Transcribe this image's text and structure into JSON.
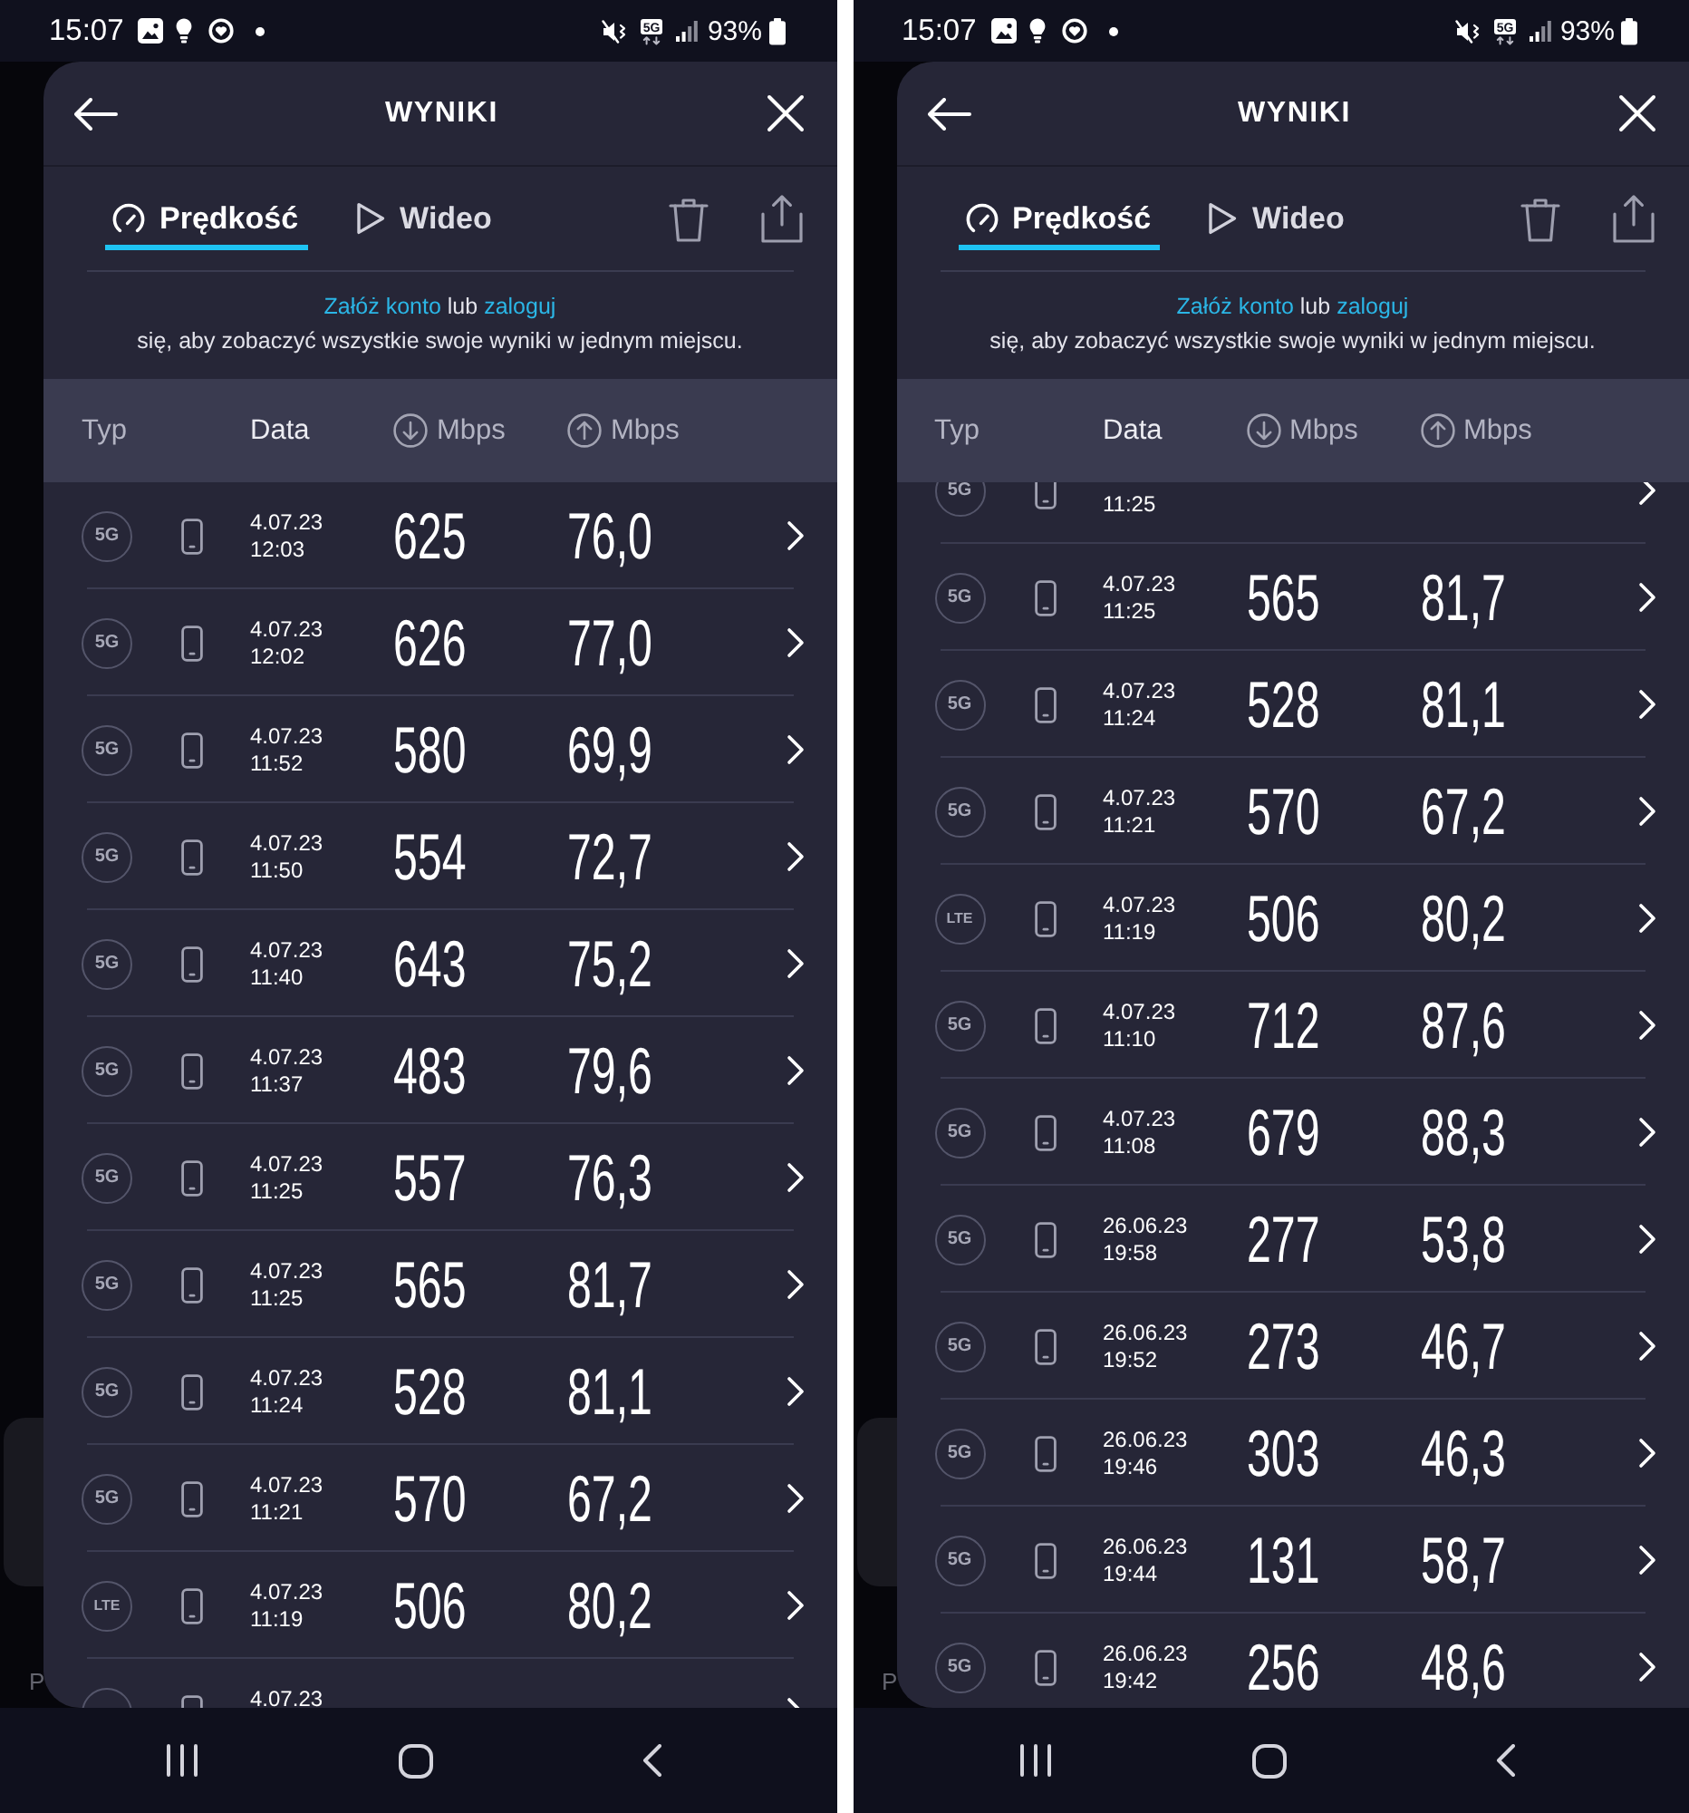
{
  "screens": [
    {
      "status_bar": {
        "time": "15:07",
        "network": "5G",
        "battery": "93%"
      },
      "background": {
        "text": "P"
      },
      "header": {
        "title": "WYNIKI"
      },
      "tabs": [
        {
          "label": "Prędkość",
          "kind": "speed",
          "selected": true
        },
        {
          "label": "Wideo",
          "kind": "video",
          "selected": false
        }
      ],
      "notice": {
        "lines": [
          [
            {
              "text": "Załóż konto",
              "kind": "link"
            },
            {
              "text": "lub",
              "kind": "text"
            },
            {
              "text": "zaloguj",
              "kind": "link"
            }
          ],
          [
            {
              "text": "się, aby zobaczyć wszystkie swoje wyniki w jednym miejscu.",
              "kind": "text"
            }
          ]
        ]
      },
      "table": {
        "columns": [
          {
            "label": "Typ",
            "selected": false
          },
          {
            "label": "Data",
            "selected": true
          },
          {
            "label": "Mbps",
            "kind": "download",
            "selected": false
          },
          {
            "label": "Mbps",
            "kind": "upload",
            "selected": false
          }
        ],
        "rows": [
          {
            "network": "5G",
            "date": "4.07.23",
            "time": "12:03",
            "download": "625",
            "upload": "76,0"
          },
          {
            "network": "5G",
            "date": "4.07.23",
            "time": "12:02",
            "download": "626",
            "upload": "77,0"
          },
          {
            "network": "5G",
            "date": "4.07.23",
            "time": "11:52",
            "download": "580",
            "upload": "69,9"
          },
          {
            "network": "5G",
            "date": "4.07.23",
            "time": "11:50",
            "download": "554",
            "upload": "72,7"
          },
          {
            "network": "5G",
            "date": "4.07.23",
            "time": "11:40",
            "download": "643",
            "upload": "75,2"
          },
          {
            "network": "5G",
            "date": "4.07.23",
            "time": "11:37",
            "download": "483",
            "upload": "79,6"
          },
          {
            "network": "5G",
            "date": "4.07.23",
            "time": "11:25",
            "download": "557",
            "upload": "76,3"
          },
          {
            "network": "5G",
            "date": "4.07.23",
            "time": "11:25",
            "download": "565",
            "upload": "81,7"
          },
          {
            "network": "5G",
            "date": "4.07.23",
            "time": "11:24",
            "download": "528",
            "upload": "81,1"
          },
          {
            "network": "5G",
            "date": "4.07.23",
            "time": "11:21",
            "download": "570",
            "upload": "67,2"
          },
          {
            "network": "LTE",
            "date": "4.07.23",
            "time": "11:19",
            "download": "506",
            "upload": "80,2"
          },
          {
            "date": "4.07.23"
          }
        ]
      }
    },
    {
      "status_bar": {
        "time": "15:07",
        "network": "5G",
        "battery": "93%"
      },
      "background": {
        "text": "P"
      },
      "header": {
        "title": "WYNIKI"
      },
      "tabs": [
        {
          "label": "Prędkość",
          "kind": "speed",
          "selected": true
        },
        {
          "label": "Wideo",
          "kind": "video",
          "selected": false
        }
      ],
      "notice": {
        "lines": [
          [
            {
              "text": "Załóż konto",
              "kind": "link"
            },
            {
              "text": "lub",
              "kind": "text"
            },
            {
              "text": "zaloguj",
              "kind": "link"
            }
          ],
          [
            {
              "text": "się, aby zobaczyć wszystkie swoje wyniki w jednym miejscu.",
              "kind": "text"
            }
          ]
        ]
      },
      "table": {
        "columns": [
          {
            "label": "Typ",
            "selected": false
          },
          {
            "label": "Data",
            "selected": true
          },
          {
            "label": "Mbps",
            "kind": "download",
            "selected": false
          },
          {
            "label": "Mbps",
            "kind": "upload",
            "selected": false
          }
        ],
        "rows": [
          {
            "network": "5G",
            "time": "11:25",
            "clipped": true
          },
          {
            "network": "5G",
            "date": "4.07.23",
            "time": "11:25",
            "download": "565",
            "upload": "81,7"
          },
          {
            "network": "5G",
            "date": "4.07.23",
            "time": "11:24",
            "download": "528",
            "upload": "81,1"
          },
          {
            "network": "5G",
            "date": "4.07.23",
            "time": "11:21",
            "download": "570",
            "upload": "67,2"
          },
          {
            "network": "LTE",
            "date": "4.07.23",
            "time": "11:19",
            "download": "506",
            "upload": "80,2"
          },
          {
            "network": "5G",
            "date": "4.07.23",
            "time": "11:10",
            "download": "712",
            "upload": "87,6"
          },
          {
            "network": "5G",
            "date": "4.07.23",
            "time": "11:08",
            "download": "679",
            "upload": "88,3"
          },
          {
            "network": "5G",
            "date": "26.06.23",
            "time": "19:58",
            "download": "277",
            "upload": "53,8"
          },
          {
            "network": "5G",
            "date": "26.06.23",
            "time": "19:52",
            "download": "273",
            "upload": "46,7"
          },
          {
            "network": "5G",
            "date": "26.06.23",
            "time": "19:46",
            "download": "303",
            "upload": "46,3"
          },
          {
            "network": "5G",
            "date": "26.06.23",
            "time": "19:44",
            "download": "131",
            "upload": "58,7"
          },
          {
            "network": "5G",
            "date": "26.06.23",
            "time": "19:42",
            "download": "256",
            "upload": "48,6"
          }
        ]
      }
    }
  ]
}
